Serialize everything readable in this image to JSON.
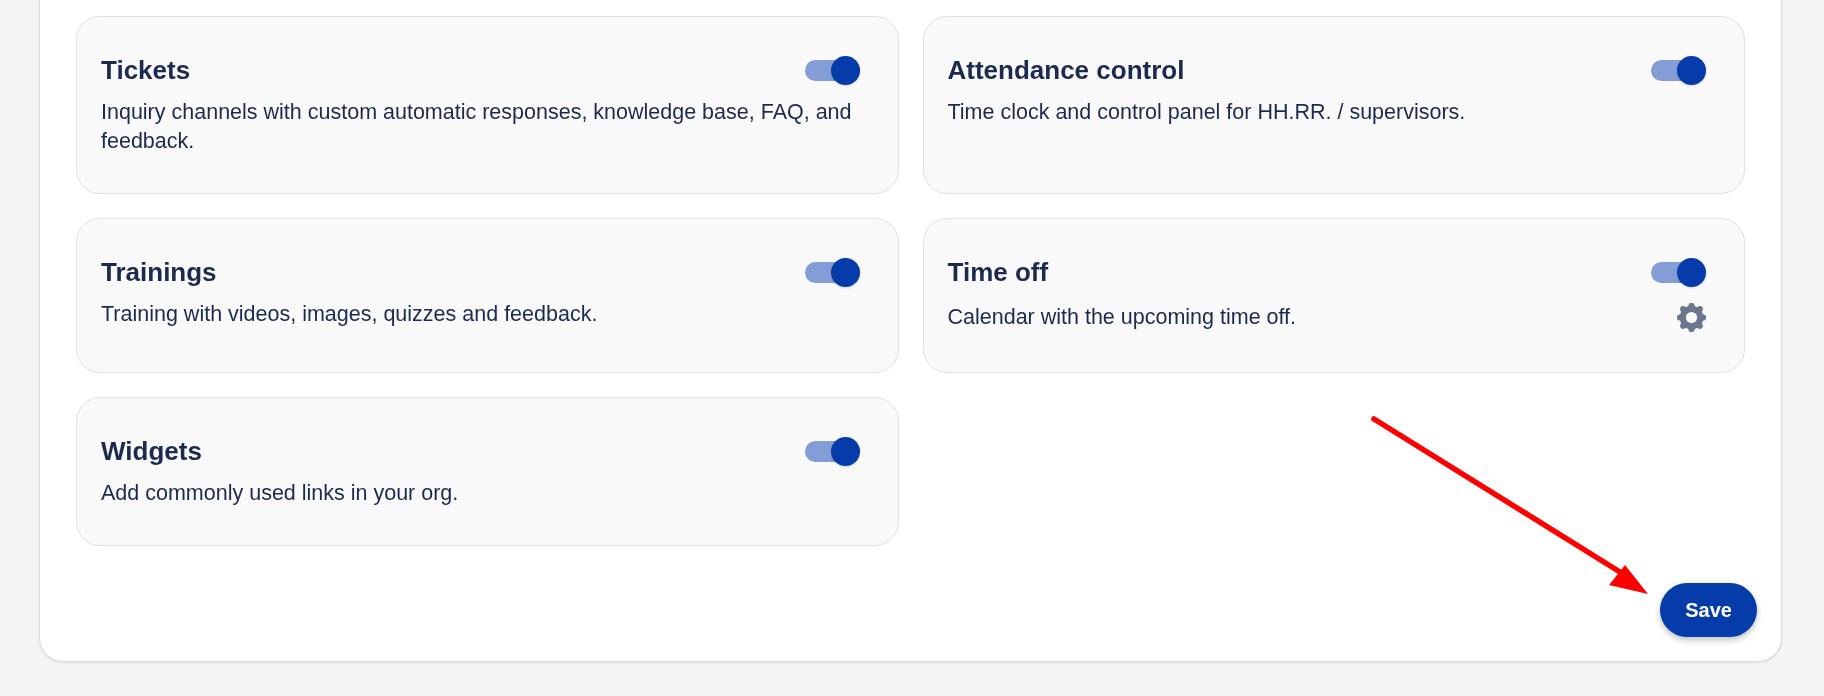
{
  "modules": [
    {
      "title": "Tickets",
      "description": "Inquiry channels with custom automatic responses, knowledge base, FAQ, and feedback.",
      "on": true,
      "settings": false
    },
    {
      "title": "Attendance control",
      "description": "Time clock and control panel for HH.RR. / supervisors.",
      "on": true,
      "settings": false
    },
    {
      "title": "Trainings",
      "description": "Training with videos, images, quizzes and feedback.",
      "on": true,
      "settings": false
    },
    {
      "title": "Time off",
      "description": "Calendar with the upcoming time off.",
      "on": true,
      "settings": true
    },
    {
      "title": "Widgets",
      "description": "Add commonly used links in your org.",
      "on": true,
      "settings": false
    }
  ],
  "save_button": {
    "label": "Save"
  }
}
